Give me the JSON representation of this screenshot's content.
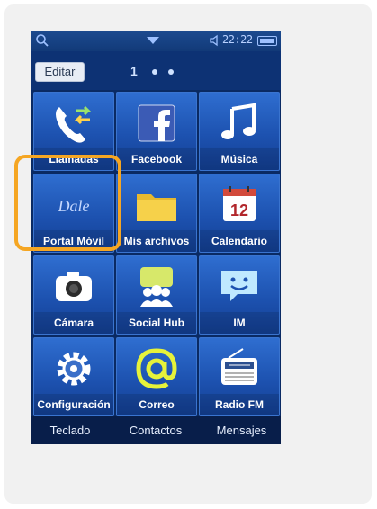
{
  "status_bar": {
    "time": "22:22",
    "icons": [
      "search-icon",
      "chevron-down-icon",
      "speaker-icon",
      "battery-icon"
    ]
  },
  "toolbar": {
    "edit_label": "Editar",
    "page_number": "1",
    "page_dots": 2
  },
  "apps": [
    {
      "label": "Llamadas",
      "icon": "phone-icon"
    },
    {
      "label": "Facebook",
      "icon": "facebook-icon"
    },
    {
      "label": "Música",
      "icon": "music-note-icon"
    },
    {
      "label": "Portal Móvil",
      "icon": "dale-logo-icon"
    },
    {
      "label": "Mis archivos",
      "icon": "folder-icon"
    },
    {
      "label": "Calendario",
      "icon": "calendar-icon",
      "calendar_day": "12"
    },
    {
      "label": "Cámara",
      "icon": "camera-icon"
    },
    {
      "label": "Social Hub",
      "icon": "people-icon"
    },
    {
      "label": "IM",
      "icon": "chat-smile-icon"
    },
    {
      "label": "Configuración",
      "icon": "gear-icon"
    },
    {
      "label": "Correo",
      "icon": "at-sign-icon"
    },
    {
      "label": "Radio FM",
      "icon": "radio-icon"
    }
  ],
  "dock": [
    {
      "label": "Teclado"
    },
    {
      "label": "Contactos"
    },
    {
      "label": "Mensajes"
    }
  ],
  "logo_text": "Dale",
  "colors": {
    "highlight": "#f5a623",
    "tile_blue": "#1d52b0",
    "screen_bg": "#0a2a63"
  }
}
